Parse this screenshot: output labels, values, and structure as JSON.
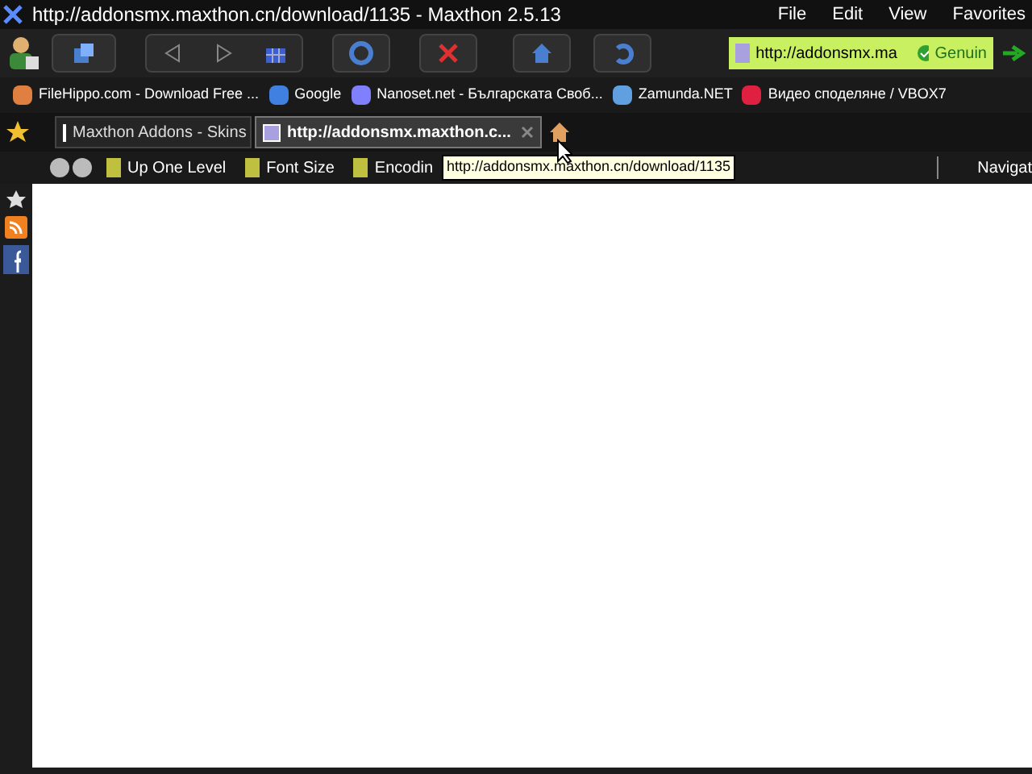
{
  "window": {
    "title": "http://addonsmx.maxthon.cn/download/1135 - Maxthon 2.5.13"
  },
  "menu": [
    "File",
    "Edit",
    "View",
    "Favorites"
  ],
  "address": {
    "value": "http://addonsmx.ma",
    "badge": "Genuin"
  },
  "bookmarks": [
    {
      "label": "FileHippo.com - Download Free ..."
    },
    {
      "label": "Google"
    },
    {
      "label": "Nanoset.net - Българската Своб..."
    },
    {
      "label": "Zamunda.NET"
    },
    {
      "label": "Видео споделяне / VBOX7"
    }
  ],
  "tabs": [
    {
      "label": "Maxthon Addons - Skins",
      "selected": false
    },
    {
      "label": "http://addonsmx.maxthon.c...",
      "selected": true
    }
  ],
  "subtoolbar": [
    {
      "label": "Up One Level"
    },
    {
      "label": "Font Size"
    },
    {
      "label": "Encodin"
    }
  ],
  "navigation": "Navigat",
  "tooltip": "http://addonsmx.maxthon.cn/download/1135"
}
